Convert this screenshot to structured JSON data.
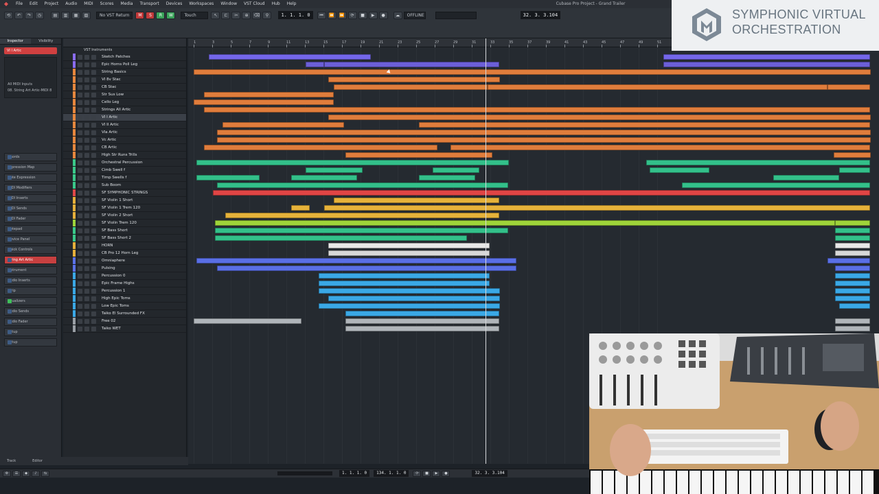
{
  "menubar": {
    "items": [
      "File",
      "Edit",
      "Project",
      "Audio",
      "MIDI",
      "Scores",
      "Media",
      "Transport",
      "Devices",
      "Workspaces",
      "Window",
      "VST Cloud",
      "Hub",
      "Help"
    ],
    "window_title": "Cubase Pro Project - Grand Trailer"
  },
  "toolbar": {
    "status": "OFFLINE",
    "position": "32. 3. 3.104",
    "left_locator": "1. 1. 1. 0",
    "right_locator": "134. 1. 1. 0",
    "mode": "Touch"
  },
  "inspector": {
    "tabs": [
      "Inspector",
      "Visibility"
    ],
    "track_name": "VI I Artic",
    "input": "All MIDI Inputs",
    "output": "08. String Art Artic-MIDI 8",
    "sections": [
      {
        "label": "Chords",
        "active": false
      },
      {
        "label": "Expression Map",
        "active": false
      },
      {
        "label": "Note Expression",
        "active": false
      },
      {
        "label": "MIDI Modifiers",
        "active": false
      },
      {
        "label": "MIDI Inserts",
        "active": false
      },
      {
        "label": "MIDI Sends",
        "active": false
      },
      {
        "label": "MIDI Fader",
        "active": false
      },
      {
        "label": "Notepad",
        "active": false
      },
      {
        "label": "Device Panel",
        "active": false
      },
      {
        "label": "Quick Controls",
        "active": false
      },
      {
        "label": "String Art Artic",
        "active": true
      },
      {
        "label": "Instrument",
        "active": false
      },
      {
        "label": "Audio Inserts",
        "active": false
      },
      {
        "label": "Strip",
        "active": false
      },
      {
        "label": "Equalizers",
        "active": false
      },
      {
        "label": "Audio Sends",
        "active": false
      },
      {
        "label": "Audio Fader",
        "active": false
      },
      {
        "label": "Setup",
        "active": false
      },
      {
        "label": "Setup",
        "active": false
      }
    ]
  },
  "tracklist": {
    "folder": "VST Instruments",
    "tracks": [
      {
        "name": "Sketch Patches",
        "color": "#8a6cf0"
      },
      {
        "name": "Epic Horns Poll Leg",
        "color": "#8a6cf0"
      },
      {
        "name": "String Basics",
        "color": "#e7873d"
      },
      {
        "name": "VI 8v Stac",
        "color": "#e7873d"
      },
      {
        "name": "CB Stac",
        "color": "#e7873d"
      },
      {
        "name": "Str Sus Low",
        "color": "#e7873d"
      },
      {
        "name": "Cello Leg",
        "color": "#e7873d"
      },
      {
        "name": "Strings All Artic",
        "color": "#e7873d"
      },
      {
        "name": "VI I Artic",
        "color": "#e7873d",
        "selected": true
      },
      {
        "name": "VI II Artic",
        "color": "#e7873d"
      },
      {
        "name": "Vla Artic",
        "color": "#e7873d"
      },
      {
        "name": "Vc Artic",
        "color": "#e7873d"
      },
      {
        "name": "CB Artic",
        "color": "#e7873d"
      },
      {
        "name": "High Str Runs Trills",
        "color": "#e7873d"
      },
      {
        "name": "Orchestral Percussion",
        "color": "#3ac98a"
      },
      {
        "name": "Cimb Swell f",
        "color": "#3ac98a"
      },
      {
        "name": "Timp Swells f",
        "color": "#3ac98a"
      },
      {
        "name": "Sub Boom",
        "color": "#3ac98a"
      },
      {
        "name": "SF SYMPHONIC STRINGS",
        "color": "#e04848"
      },
      {
        "name": "SF Violin 1 Short",
        "color": "#e6b03a"
      },
      {
        "name": "SF Violin 1 Trem 120",
        "color": "#e6b03a"
      },
      {
        "name": "SF Violin 2 Short",
        "color": "#e6b03a"
      },
      {
        "name": "SF Violin Trem 120",
        "color": "#9fd43a"
      },
      {
        "name": "SF Bass Short",
        "color": "#3ac98a"
      },
      {
        "name": "SF Bass Short 2",
        "color": "#3ac98a"
      },
      {
        "name": "HORN",
        "color": "#e6b03a"
      },
      {
        "name": "CB Pro 12 Horn Leg",
        "color": "#e6b03a"
      },
      {
        "name": "Omniaphere",
        "color": "#5b72e8"
      },
      {
        "name": "Pulsing",
        "color": "#5b72e8"
      },
      {
        "name": "Percussion 0",
        "color": "#3aa8e6"
      },
      {
        "name": "Epic Frame Highs",
        "color": "#3aa8e6"
      },
      {
        "name": "Percussion 1",
        "color": "#3aa8e6"
      },
      {
        "name": "High Epic Toms",
        "color": "#3aa8e6"
      },
      {
        "name": "Low Epic Toms",
        "color": "#3aa8e6"
      },
      {
        "name": "Taiko El Surrounded FX",
        "color": "#3aa8e6"
      },
      {
        "name": "Free 02",
        "color": "#9aa0a6"
      },
      {
        "name": "Taiko WET",
        "color": "#9aa0a6"
      }
    ]
  },
  "ruler": {
    "bars": [
      "1",
      "3",
      "5",
      "7",
      "9",
      "11",
      "13",
      "15",
      "17",
      "19",
      "21",
      "23",
      "25",
      "27",
      "29",
      "31",
      "33",
      "35",
      "37",
      "39",
      "41",
      "43",
      "45",
      "47",
      "49",
      "51"
    ]
  },
  "parts": [
    {
      "track": 0,
      "start": 1.6,
      "end": 19.1,
      "color": "#7467ea"
    },
    {
      "track": 0,
      "start": 50.7,
      "end": 73,
      "color": "#7467ea"
    },
    {
      "track": 1,
      "start": 12.1,
      "end": 14.1,
      "color": "#6c5fd8"
    },
    {
      "track": 1,
      "start": 14.1,
      "end": 33,
      "color": "#6c5fd8"
    },
    {
      "track": 1,
      "start": 50.7,
      "end": 73,
      "color": "#6c5fd8"
    },
    {
      "track": 2,
      "start": 0,
      "end": 73,
      "color": "#e07d3c"
    },
    {
      "track": 3,
      "start": 14.5,
      "end": 33,
      "color": "#e07d3c"
    },
    {
      "track": 4,
      "start": 15.1,
      "end": 31.7,
      "color": "#e07d3c"
    },
    {
      "track": 4,
      "start": 31.7,
      "end": 68.4,
      "color": "#e07d3c"
    },
    {
      "track": 4,
      "start": 68.4,
      "end": 73,
      "color": "#e07d3c"
    },
    {
      "track": 5,
      "start": 1.1,
      "end": 15.1,
      "color": "#e07d3c"
    },
    {
      "track": 6,
      "start": 0,
      "end": 15.1,
      "color": "#e07d3c"
    },
    {
      "track": 7,
      "start": 1.1,
      "end": 73,
      "color": "#e07d3c"
    },
    {
      "track": 8,
      "start": 14.5,
      "end": 73,
      "color": "#e07d3c"
    },
    {
      "track": 9,
      "start": 3.1,
      "end": 16.2,
      "color": "#e07d3c"
    },
    {
      "track": 9,
      "start": 24.3,
      "end": 73,
      "color": "#e07d3c"
    },
    {
      "track": 10,
      "start": 2.5,
      "end": 73,
      "color": "#e07d3c"
    },
    {
      "track": 11,
      "start": 2.5,
      "end": 73,
      "color": "#e07d3c"
    },
    {
      "track": 12,
      "start": 1.1,
      "end": 26.3,
      "color": "#e07d3c"
    },
    {
      "track": 12,
      "start": 27.7,
      "end": 73,
      "color": "#e07d3c"
    },
    {
      "track": 13,
      "start": 16.4,
      "end": 32.2,
      "color": "#e07d3c"
    },
    {
      "track": 13,
      "start": 69,
      "end": 73,
      "color": "#e07d3c"
    },
    {
      "track": 14,
      "start": 0.3,
      "end": 34,
      "color": "#33c08a"
    },
    {
      "track": 14,
      "start": 48.8,
      "end": 73,
      "color": "#33c08a"
    },
    {
      "track": 15,
      "start": 12.1,
      "end": 18.2,
      "color": "#33c08a"
    },
    {
      "track": 15,
      "start": 25.8,
      "end": 30.8,
      "color": "#33c08a"
    },
    {
      "track": 15,
      "start": 49.2,
      "end": 55.6,
      "color": "#33c08a"
    },
    {
      "track": 15,
      "start": 69.6,
      "end": 73,
      "color": "#33c08a"
    },
    {
      "track": 16,
      "start": 0.3,
      "end": 7.1,
      "color": "#33c08a"
    },
    {
      "track": 16,
      "start": 10.5,
      "end": 17.6,
      "color": "#33c08a"
    },
    {
      "track": 16,
      "start": 24.3,
      "end": 30.4,
      "color": "#33c08a"
    },
    {
      "track": 16,
      "start": 62.5,
      "end": 69.6,
      "color": "#33c08a"
    },
    {
      "track": 17,
      "start": 2.5,
      "end": 33.9,
      "color": "#33c08a"
    },
    {
      "track": 17,
      "start": 52.7,
      "end": 73,
      "color": "#33c08a"
    },
    {
      "track": 18,
      "start": 2.1,
      "end": 73,
      "color": "#e04545"
    },
    {
      "track": 19,
      "start": 15.1,
      "end": 33,
      "color": "#e6b23a"
    },
    {
      "track": 20,
      "start": 10.5,
      "end": 12.5,
      "color": "#e6b23a"
    },
    {
      "track": 20,
      "start": 14.1,
      "end": 73,
      "color": "#e6b23a"
    },
    {
      "track": 21,
      "start": 3.4,
      "end": 33,
      "color": "#e6b23a"
    },
    {
      "track": 22,
      "start": 2.3,
      "end": 69.2,
      "color": "#9fd43a"
    },
    {
      "track": 22,
      "start": 69.2,
      "end": 73,
      "color": "#9fd43a"
    },
    {
      "track": 23,
      "start": 2.3,
      "end": 33.9,
      "color": "#33c08a"
    },
    {
      "track": 23,
      "start": 69.2,
      "end": 73,
      "color": "#33c08a"
    },
    {
      "track": 24,
      "start": 2.3,
      "end": 29.5,
      "color": "#33c08a"
    },
    {
      "track": 24,
      "start": 69.2,
      "end": 73,
      "color": "#33c08a"
    },
    {
      "track": 25,
      "start": 14.5,
      "end": 31.9,
      "color": "#e8e8e8"
    },
    {
      "track": 25,
      "start": 69.2,
      "end": 73,
      "color": "#e8e8e8"
    },
    {
      "track": 26,
      "start": 14.5,
      "end": 31.9,
      "color": "#d8d8d8"
    },
    {
      "track": 26,
      "start": 69.2,
      "end": 73,
      "color": "#d8d8d8"
    },
    {
      "track": 27,
      "start": 0.3,
      "end": 34.8,
      "color": "#5a6fe6"
    },
    {
      "track": 27,
      "start": 68.4,
      "end": 73,
      "color": "#5a6fe6"
    },
    {
      "track": 28,
      "start": 2.5,
      "end": 34.8,
      "color": "#5a6fe6"
    },
    {
      "track": 28,
      "start": 69.2,
      "end": 73,
      "color": "#5a6fe6"
    },
    {
      "track": 29,
      "start": 13.5,
      "end": 31.9,
      "color": "#3aa8e6"
    },
    {
      "track": 29,
      "start": 69.2,
      "end": 73,
      "color": "#3aa8e6"
    },
    {
      "track": 30,
      "start": 13.5,
      "end": 31.9,
      "color": "#3aa8e6"
    },
    {
      "track": 30,
      "start": 69.2,
      "end": 73,
      "color": "#3aa8e6"
    },
    {
      "track": 31,
      "start": 13.5,
      "end": 33,
      "color": "#3aa8e6"
    },
    {
      "track": 31,
      "start": 69.2,
      "end": 73,
      "color": "#3aa8e6"
    },
    {
      "track": 32,
      "start": 14.5,
      "end": 33,
      "color": "#3aa8e6"
    },
    {
      "track": 32,
      "start": 69.2,
      "end": 73,
      "color": "#3aa8e6"
    },
    {
      "track": 33,
      "start": 13.5,
      "end": 33,
      "color": "#3aa8e6"
    },
    {
      "track": 33,
      "start": 69.6,
      "end": 73,
      "color": "#3aa8e6"
    },
    {
      "track": 34,
      "start": 16.4,
      "end": 33,
      "color": "#3aa8e6"
    },
    {
      "track": 35,
      "start": 0,
      "end": 11.6,
      "color": "#b0b5ba"
    },
    {
      "track": 35,
      "start": 16.4,
      "end": 33,
      "color": "#b0b5ba"
    },
    {
      "track": 35,
      "start": 69.2,
      "end": 73,
      "color": "#b0b5ba"
    },
    {
      "track": 36,
      "start": 16.4,
      "end": 33,
      "color": "#b0b5ba"
    },
    {
      "track": 36,
      "start": 69.2,
      "end": 73,
      "color": "#b0b5ba"
    }
  ],
  "transport": {
    "left": "1. 1. 1. 0",
    "right": "134. 1. 1. 0",
    "position": "32. 3. 3.104"
  },
  "bottom_tabs": [
    "Track",
    "Editor"
  ],
  "watermark": {
    "line1": "SYMPHONIC VIRTUAL",
    "line2": "ORCHESTRATION"
  }
}
